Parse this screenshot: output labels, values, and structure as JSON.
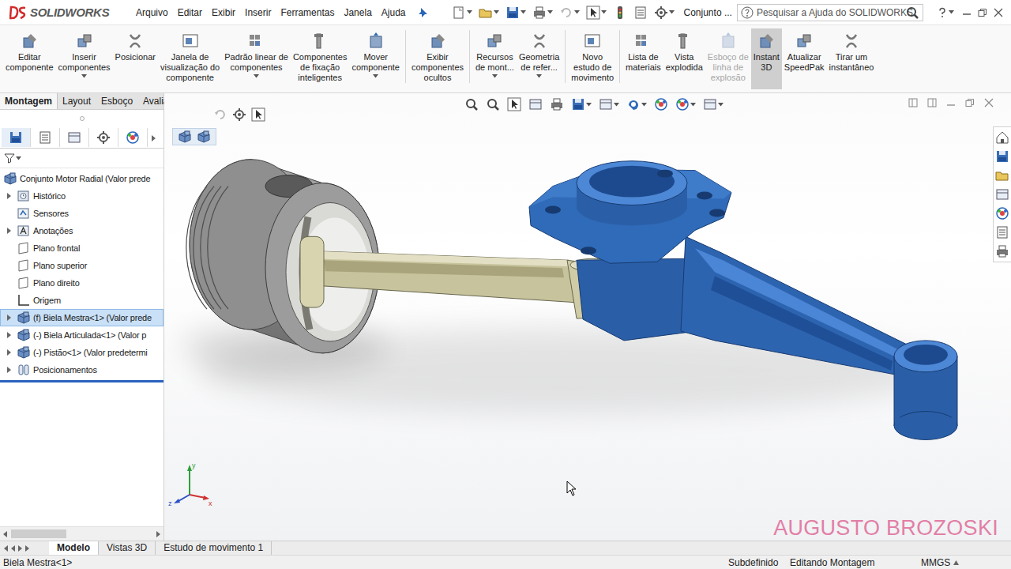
{
  "app": {
    "logo": "SOLIDWORKS",
    "document_title": "Conjunto ...",
    "search": {
      "placeholder": "Pesquisar a Ajuda do SOLIDWORKS"
    }
  },
  "menu": [
    "Arquivo",
    "Editar",
    "Exibir",
    "Inserir",
    "Ferramentas",
    "Janela",
    "Ajuda"
  ],
  "ribbon": [
    {
      "label": "Editar\ncomponente",
      "dropdown": false,
      "selected": false,
      "disabled": false
    },
    {
      "label": "Inserir\ncomponentes",
      "dropdown": true,
      "selected": false,
      "disabled": false
    },
    {
      "label": "Posicionar",
      "dropdown": false,
      "selected": false,
      "disabled": false
    },
    {
      "label": "Janela de\nvisualização do\ncomponente",
      "dropdown": false,
      "selected": false,
      "disabled": false
    },
    {
      "label": "Padrão linear de\ncomponentes",
      "dropdown": true,
      "selected": false,
      "disabled": false
    },
    {
      "label": "Componentes\nde fixação\ninteligentes",
      "dropdown": false,
      "selected": false,
      "disabled": false
    },
    {
      "label": "Mover\ncomponente",
      "dropdown": true,
      "selected": false,
      "disabled": false
    },
    {
      "label": "Exibir\ncomponentes\nocultos",
      "dropdown": false,
      "selected": false,
      "disabled": false
    },
    {
      "label": "Recursos\nde mont...",
      "dropdown": true,
      "selected": false,
      "disabled": false
    },
    {
      "label": "Geometria\nde refer...",
      "dropdown": true,
      "selected": false,
      "disabled": false
    },
    {
      "label": "Novo\nestudo de\nmovimento",
      "dropdown": false,
      "selected": false,
      "disabled": false
    },
    {
      "label": "Lista de\nmateriais",
      "dropdown": false,
      "selected": false,
      "disabled": false
    },
    {
      "label": "Vista\nexplodida",
      "dropdown": false,
      "selected": false,
      "disabled": false
    },
    {
      "label": "Esboço de\nlinha de\nexplosão",
      "dropdown": false,
      "selected": false,
      "disabled": true
    },
    {
      "label": "Instant\n3D",
      "dropdown": false,
      "selected": true,
      "disabled": false
    },
    {
      "label": "Atualizar\nSpeedPak",
      "dropdown": false,
      "selected": false,
      "disabled": false
    },
    {
      "label": "Tirar um\ninstantâneo",
      "dropdown": false,
      "selected": false,
      "disabled": false
    }
  ],
  "command_tabs": [
    {
      "label": "Montagem",
      "selected": true
    },
    {
      "label": "Layout",
      "selected": false
    },
    {
      "label": "Esboço",
      "selected": false
    },
    {
      "label": "Avaliar",
      "selected": false
    }
  ],
  "feature_tree": {
    "root": "Conjunto Motor Radial (Valor prede",
    "items": [
      {
        "label": "Histórico",
        "kind": "history",
        "expandable": true,
        "selected": false
      },
      {
        "label": "Sensores",
        "kind": "sensor",
        "expandable": false,
        "selected": false
      },
      {
        "label": "Anotações",
        "kind": "annotation",
        "expandable": true,
        "selected": false
      },
      {
        "label": "Plano frontal",
        "kind": "plane",
        "expandable": false,
        "selected": false
      },
      {
        "label": "Plano superior",
        "kind": "plane",
        "expandable": false,
        "selected": false
      },
      {
        "label": "Plano direito",
        "kind": "plane",
        "expandable": false,
        "selected": false
      },
      {
        "label": "Origem",
        "kind": "origin",
        "expandable": false,
        "selected": false
      },
      {
        "label": "(f) Biela Mestra<1> (Valor prede",
        "kind": "component",
        "expandable": true,
        "selected": true
      },
      {
        "label": "(-) Biela Articulada<1> (Valor p",
        "kind": "component",
        "expandable": true,
        "selected": false
      },
      {
        "label": "(-) Pistão<1> (Valor predetermi",
        "kind": "component",
        "expandable": true,
        "selected": false
      },
      {
        "label": "Posicionamentos",
        "kind": "mates",
        "expandable": true,
        "selected": false
      }
    ]
  },
  "graphics": {
    "watermark": "AUGUSTO BROZOSKI",
    "triad": [
      {
        "label": "y",
        "color": "#2e9e3a"
      },
      {
        "label": "x",
        "color": "#d03030"
      },
      {
        "label": "z",
        "color": "#2a4fc8"
      }
    ]
  },
  "bottom_tabs": [
    {
      "label": "Modelo",
      "selected": true
    },
    {
      "label": "Vistas 3D",
      "selected": false
    },
    {
      "label": "Estudo de movimento 1",
      "selected": false
    }
  ],
  "status_bar": {
    "selection": "Biela Mestra<1>",
    "state": "Subdefinido",
    "mode": "Editando Montagem",
    "units": "MMGS"
  }
}
